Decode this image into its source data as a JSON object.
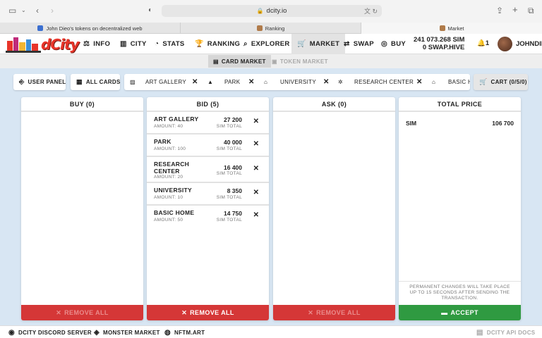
{
  "browser": {
    "url": "dcity.io",
    "tabs": [
      {
        "label": "John Dieo's tokens on decentralized web",
        "fav_color": "#3b6fd0"
      },
      {
        "label": "Ranking",
        "fav_color": "#b07b4a"
      },
      {
        "label": "Market",
        "fav_color": "#b07b4a"
      }
    ]
  },
  "nav": {
    "logo_text": "dCity",
    "items": [
      {
        "label": "INFO",
        "icon": "scale-icon"
      },
      {
        "label": "CITY",
        "icon": "city-icon"
      },
      {
        "label": "STATS",
        "icon": "chart-pie-icon"
      },
      {
        "label": "RANKING",
        "icon": "trophy-icon"
      },
      {
        "label": "EXPLORER",
        "icon": "search-icon"
      },
      {
        "label": "MARKET",
        "icon": "cart-icon"
      },
      {
        "label": "SWAP",
        "icon": "swap-icon"
      },
      {
        "label": "BUY",
        "icon": "coins-icon"
      }
    ],
    "balance_sim": "241 073.268 SIM",
    "balance_hive": "0 SWAP.HIVE",
    "notifications": "1",
    "username": "JOHNDIE"
  },
  "subnav": {
    "card_market": "CARD MARKET",
    "token_market": "TOKEN MARKET"
  },
  "toolbar": {
    "user_panel": "USER PANEL",
    "all_cards": "ALL CARDS",
    "filters": [
      "ART GALLERY",
      "PARK",
      "UNIVERSITY",
      "RESEARCH CENTER",
      "BASIC H"
    ],
    "cart": "CART (0/5/0)"
  },
  "panels": {
    "buy": {
      "title": "BUY (0)",
      "remove_all": "REMOVE ALL"
    },
    "bid": {
      "title": "BID (5)",
      "remove_all": "REMOVE ALL",
      "unit_label": "SIM TOTAL",
      "rows": [
        {
          "name": "ART GALLERY",
          "amount": "AMOUNT: 40",
          "total": "27 200"
        },
        {
          "name": "PARK",
          "amount": "AMOUNT: 100",
          "total": "40 000"
        },
        {
          "name": "RESEARCH CENTER",
          "amount": "AMOUNT: 20",
          "total": "16 400"
        },
        {
          "name": "UNIVERSITY",
          "amount": "AMOUNT: 10",
          "total": "8 350"
        },
        {
          "name": "BASIC HOME",
          "amount": "AMOUNT: 50",
          "total": "14 750"
        }
      ]
    },
    "ask": {
      "title": "ASK (0)",
      "remove_all": "REMOVE ALL"
    },
    "total": {
      "title": "TOTAL PRICE",
      "currency": "SIM",
      "value": "106 700",
      "note": "PERMANENT CHANGES WILL TAKE PLACE UP TO 15 SECONDS AFTER SENDING THE TRANSACTION.",
      "accept": "ACCEPT"
    }
  },
  "footer": {
    "discord": "DCITY DISCORD SERVER",
    "monster": "MONSTER MARKET",
    "nftm": "NFTM.ART",
    "api_docs": "DCITY API DOCS"
  },
  "colors": {
    "page_bg": "#d8e6f3",
    "danger": "#d53737",
    "success": "#2f9a41",
    "brand": "#e8352a"
  }
}
